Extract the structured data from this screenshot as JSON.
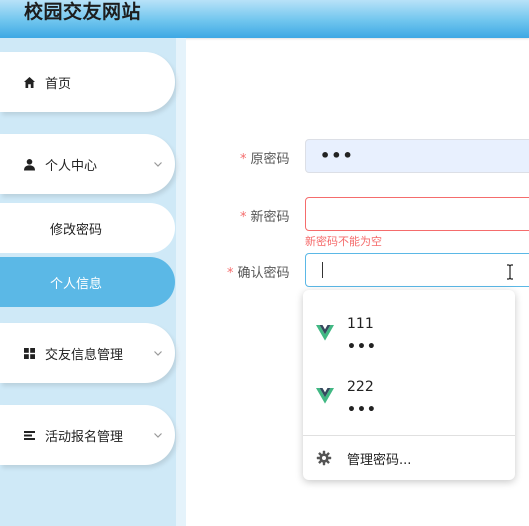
{
  "header": {
    "title": "校园交友网站"
  },
  "sidebar": {
    "items": [
      {
        "label": "首页",
        "icon": "home-icon"
      },
      {
        "label": "个人中心",
        "icon": "user-icon"
      },
      {
        "label": "交友信息管理",
        "icon": "grid-icon"
      },
      {
        "label": "活动报名管理",
        "icon": "list-icon"
      }
    ],
    "subitems": [
      {
        "label": "修改密码"
      },
      {
        "label": "个人信息"
      }
    ]
  },
  "form": {
    "old_password": {
      "label": "原密码",
      "value": "•••"
    },
    "new_password": {
      "label": "新密码",
      "value": "",
      "error": "新密码不能为空"
    },
    "confirm_password": {
      "label": "确认密码",
      "value": ""
    },
    "required_mark": "*"
  },
  "autocomplete": {
    "entries": [
      {
        "username": "111",
        "password_mask": "•••"
      },
      {
        "username": "222",
        "password_mask": "•••"
      }
    ],
    "manage_label": "管理密码..."
  },
  "colors": {
    "accent": "#5bb8e6",
    "error": "#f56c6c",
    "sidebar_bg": "#cfe9f7",
    "vue_green": "#41b883",
    "vue_dark": "#35495e"
  }
}
